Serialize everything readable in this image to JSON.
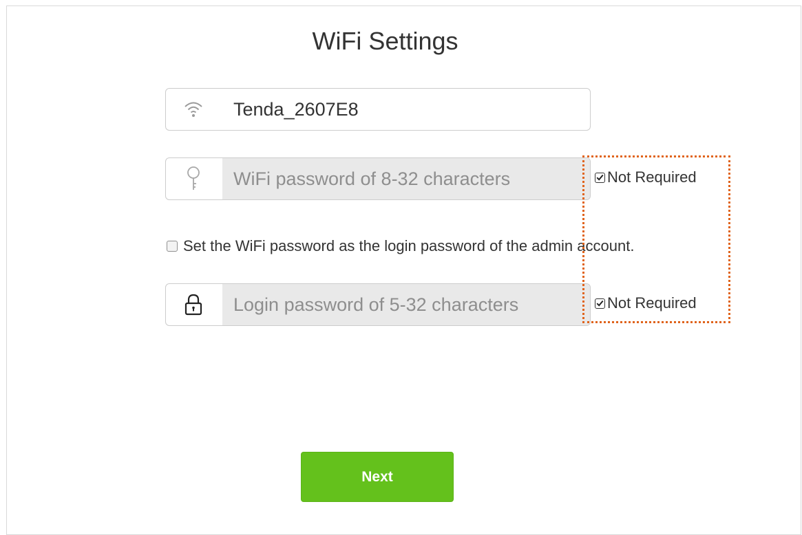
{
  "page": {
    "title": "WiFi Settings"
  },
  "wifi_name": {
    "icon": "wifi-icon",
    "value": "Tenda_2607E8"
  },
  "wifi_password": {
    "icon": "key-icon",
    "placeholder": "WiFi password of 8-32 characters",
    "not_required_label": "Not Required",
    "not_required_checked": true
  },
  "sync_option": {
    "label": "Set the WiFi password as the login password of the admin account.",
    "checked": false
  },
  "login_password": {
    "icon": "lock-icon",
    "placeholder": "Login password of 5-32 characters",
    "not_required_label": "Not Required",
    "not_required_checked": true
  },
  "actions": {
    "next_label": "Next"
  },
  "colors": {
    "accent_green": "#64c11c",
    "highlight_orange": "#e0631a",
    "disabled_field": "#e9e9e9"
  }
}
